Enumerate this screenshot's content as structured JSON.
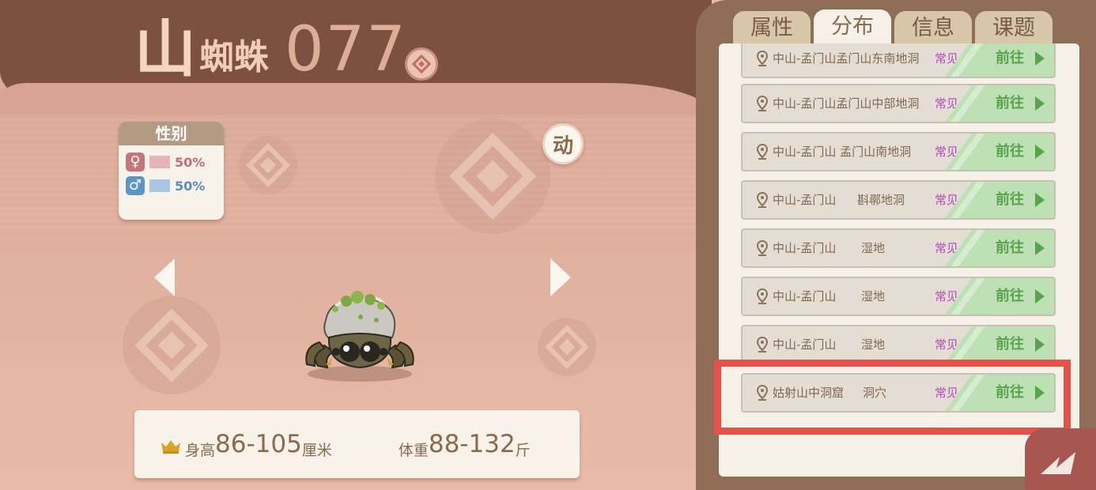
{
  "header": {
    "title_char": "山",
    "title_name": "蜘蛛",
    "number": "077"
  },
  "gender": {
    "title": "性别",
    "female": {
      "symbol": "♀",
      "percent": "50%",
      "value": 0.5
    },
    "male": {
      "symbol": "♂",
      "percent": "50%",
      "value": 0.5
    }
  },
  "animate_button": "动",
  "stats": {
    "height_label": "身高",
    "height_value": "86-105",
    "height_unit": "厘米",
    "weight_label": "体重",
    "weight_value": "88-132",
    "weight_unit": "斤"
  },
  "tabs": [
    {
      "label": "属性",
      "active": false
    },
    {
      "label": "分布",
      "active": true
    },
    {
      "label": "信息",
      "active": false
    },
    {
      "label": "课题",
      "active": false
    }
  ],
  "locations": [
    {
      "place": "中山-孟门山孟门山东南地洞",
      "sub": "",
      "freq": "常见",
      "go": "前往"
    },
    {
      "place": "中山-孟门山孟门山中部地洞",
      "sub": "",
      "freq": "常见",
      "go": "前往"
    },
    {
      "place": "中山-孟门山 孟门山南地洞",
      "sub": "",
      "freq": "常见",
      "go": "前往"
    },
    {
      "place": "中山-孟门山",
      "sub": "斟鄩地洞",
      "freq": "常见",
      "go": "前往"
    },
    {
      "place": "中山-孟门山",
      "sub": "湿地",
      "freq": "常见",
      "go": "前往"
    },
    {
      "place": "中山-孟门山",
      "sub": "湿地",
      "freq": "常见",
      "go": "前往"
    },
    {
      "place": "中山-孟门山",
      "sub": "湿地",
      "freq": "常见",
      "go": "前往"
    },
    {
      "place": "姑射山中洞窟",
      "sub": "洞穴",
      "freq": "常见",
      "go": "前往"
    }
  ],
  "colors": {
    "highlight": "#e4504a",
    "frequency": "#b24ac0",
    "go_button": "#bde0b4"
  }
}
